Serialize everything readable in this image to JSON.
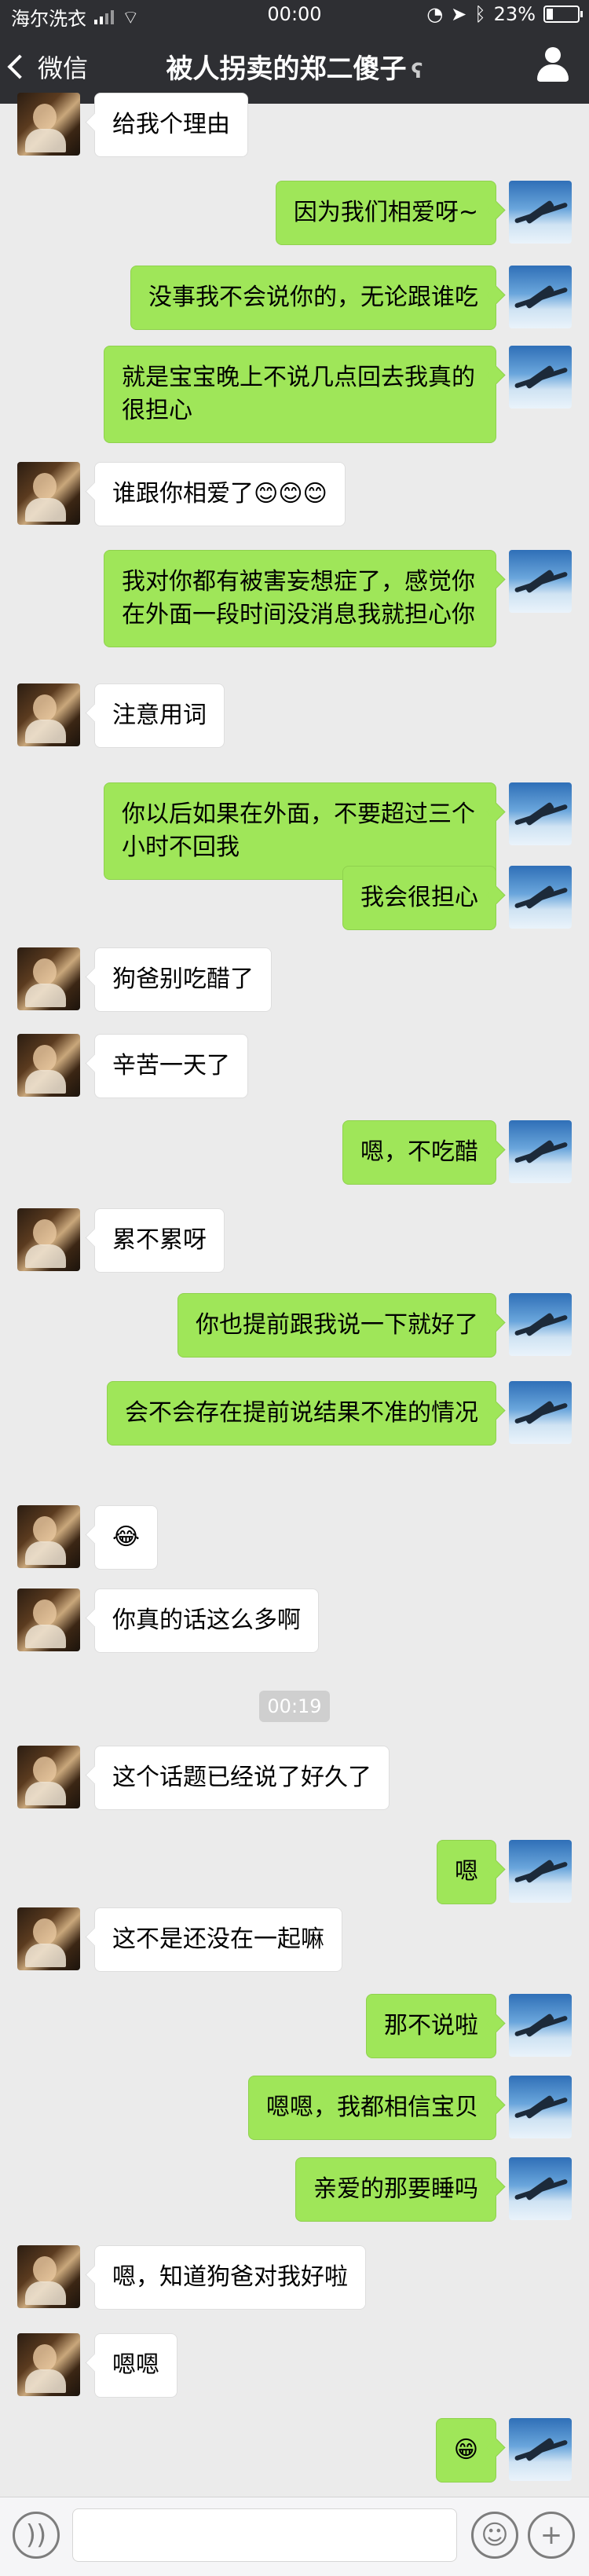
{
  "status_bar": {
    "carrier": "海尔洗衣",
    "time": "00:00",
    "battery_percent": "23%",
    "battery_level": 0.23
  },
  "nav": {
    "back_label": "微信",
    "title": "被人拐卖的郑二傻子"
  },
  "messages": [
    {
      "side": "left",
      "text": "给我个理由"
    },
    {
      "side": "right",
      "text": "因为我们相爱呀~"
    },
    {
      "side": "right",
      "text": "没事我不会说你的，无论跟谁吃"
    },
    {
      "side": "right",
      "text": "就是宝宝晚上不说几点回去我真的很担心"
    },
    {
      "side": "left",
      "text": "谁跟你相爱了😊😊😊"
    },
    {
      "side": "right",
      "text": "我对你都有被害妄想症了，感觉你在外面一段时间没消息我就担心你"
    },
    {
      "side": "left",
      "text": "注意用词"
    },
    {
      "side": "right",
      "text": "你以后如果在外面，不要超过三个小时不回我"
    },
    {
      "side": "right",
      "text": "我会很担心"
    },
    {
      "side": "left",
      "text": "狗爸别吃醋了"
    },
    {
      "side": "left",
      "text": "辛苦一天了"
    },
    {
      "side": "right",
      "text": "嗯，不吃醋"
    },
    {
      "side": "left",
      "text": "累不累呀"
    },
    {
      "side": "right",
      "text": "你也提前跟我说一下就好了"
    },
    {
      "side": "right",
      "text": "会不会存在提前说结果不准的情况"
    },
    {
      "side": "left",
      "text": "😂"
    },
    {
      "side": "left",
      "text": "你真的话这么多啊"
    },
    {
      "side": "time",
      "text": "00:19"
    },
    {
      "side": "left",
      "text": "这个话题已经说了好久了"
    },
    {
      "side": "right",
      "text": "嗯"
    },
    {
      "side": "left",
      "text": "这不是还没在一起嘛"
    },
    {
      "side": "right",
      "text": "那不说啦"
    },
    {
      "side": "right",
      "text": "嗯嗯，我都相信宝贝"
    },
    {
      "side": "right",
      "text": "亲爱的那要睡吗"
    },
    {
      "side": "left",
      "text": "嗯，知道狗爸对我好啦"
    },
    {
      "side": "left",
      "text": "嗯嗯"
    },
    {
      "side": "right",
      "text": "😁"
    }
  ],
  "input_bar": {
    "voice_icon": "voice-icon",
    "emoji_icon": "emoji-icon",
    "plus_icon": "plus-icon",
    "input_value": ""
  }
}
